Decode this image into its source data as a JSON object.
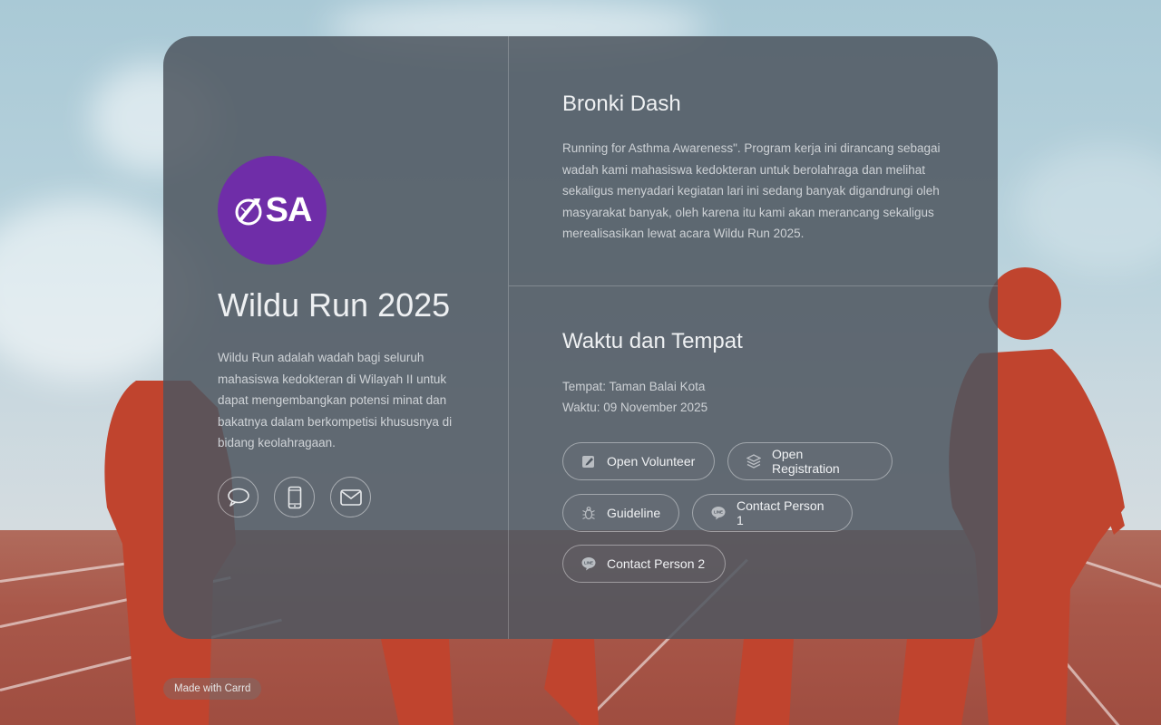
{
  "colors": {
    "card_bg": "#4e5660",
    "logo_bg": "#6f2da8",
    "text_primary": "#eef0f2",
    "text_secondary": "#cfd3d7",
    "runner": "#c0442e",
    "track": "#a9584a"
  },
  "left": {
    "logo": {
      "text": "SA",
      "icon": "sa-logo-icon"
    },
    "title": "Wildu Run 2025",
    "description": "Wildu Run adalah wadah bagi seluruh mahasiswa kedokteran di Wilayah II untuk dapat mengembangkan potensi minat dan bakatnya dalam berkompetisi khususnya di bidang keolahragaan.",
    "social": [
      {
        "icon": "chat-icon"
      },
      {
        "icon": "phone-icon"
      },
      {
        "icon": "mail-icon"
      }
    ]
  },
  "about": {
    "title": "Bronki Dash",
    "text": "Running for Asthma Awareness\". Program kerja ini dirancang sebagai wadah kami mahasiswa kedokteran untuk berolahraga dan melihat sekaligus menyadari kegiatan lari ini sedang banyak digandrungi oleh masyarakat banyak, oleh karena itu kami akan merancang sekaligus merealisasikan lewat acara Wildu Run 2025."
  },
  "schedule": {
    "title": "Waktu dan Tempat",
    "place": "Tempat: Taman Balai Kota",
    "time": "Waktu: 09 November 2025"
  },
  "buttons": [
    {
      "label": "Open Volunteer",
      "icon": "edit-icon"
    },
    {
      "label": "Open Registration",
      "icon": "layers-icon"
    },
    {
      "label": "Guideline",
      "icon": "bug-icon"
    },
    {
      "label": "Contact Person 1",
      "icon": "line-icon"
    },
    {
      "label": "Contact Person 2",
      "icon": "line-icon"
    }
  ],
  "footer": {
    "label": "Made with Carrd"
  }
}
